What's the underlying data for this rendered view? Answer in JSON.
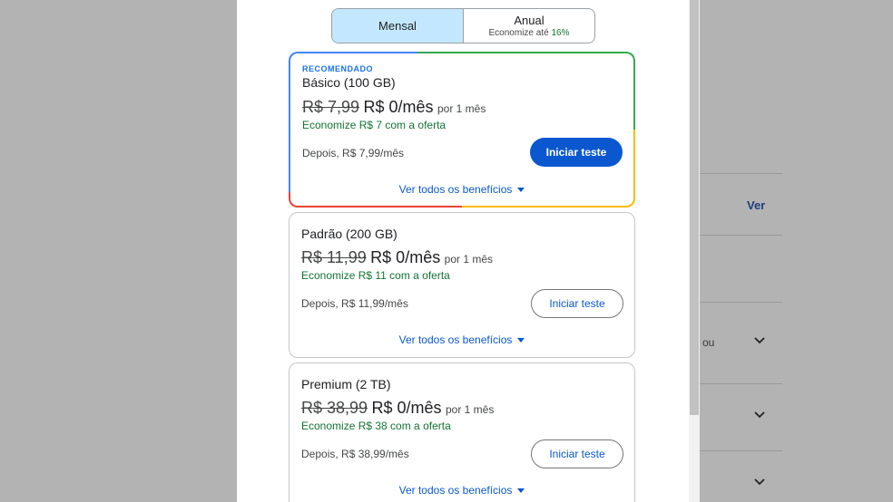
{
  "background": {
    "link_label": "Ver",
    "text_fragment": "ou"
  },
  "billing_toggle": {
    "monthly_label": "Mensal",
    "annual_label": "Anual",
    "annual_savings_prefix": "Economize até",
    "annual_savings_value": "16%"
  },
  "plans": [
    {
      "badge": "RECOMENDADO",
      "name": "Básico (100 GB)",
      "old_price": "R$ 7,99",
      "new_price": "R$ 0/mês",
      "period": "por 1 mês",
      "savings": "Economize R$ 7 com a oferta",
      "after": "Depois, R$ 7,99/mês",
      "button": "Iniciar teste",
      "benefits_link": "Ver todos os benefícios"
    },
    {
      "name": "Padrão (200 GB)",
      "old_price": "R$ 11,99",
      "new_price": "R$ 0/mês",
      "period": "por 1 mês",
      "savings": "Economize R$ 11 com a oferta",
      "after": "Depois, R$ 11,99/mês",
      "button": "Iniciar teste",
      "benefits_link": "Ver todos os benefícios"
    },
    {
      "name": "Premium (2 TB)",
      "old_price": "R$ 38,99",
      "new_price": "R$ 0/mês",
      "period": "por 1 mês",
      "savings": "Economize R$ 38 com a oferta",
      "after": "Depois, R$ 38,99/mês",
      "button": "Iniciar teste",
      "benefits_link": "Ver todos os benefícios"
    }
  ],
  "colors": {
    "accent": "#0b57d0",
    "savings_green": "#137333",
    "toggle_selected": "#c2e7ff"
  }
}
